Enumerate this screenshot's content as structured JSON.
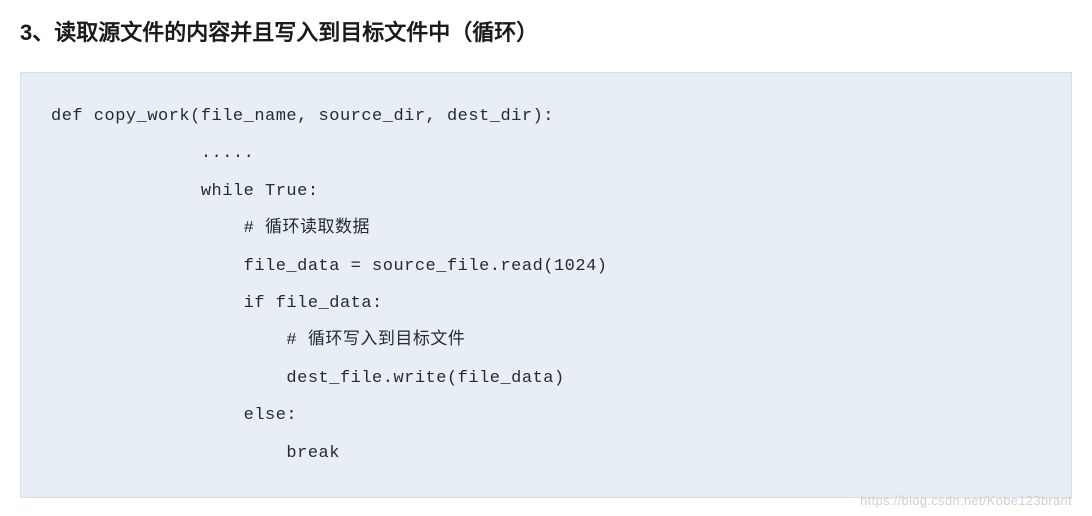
{
  "heading": "3、读取源文件的内容并且写入到目标文件中（循环）",
  "code": {
    "lines": [
      "def copy_work(file_name, source_dir, dest_dir):",
      "              .....",
      "              while True:",
      "                  # 循环读取数据",
      "                  file_data = source_file.read(1024)",
      "                  if file_data:",
      "                      # 循环写入到目标文件",
      "                      dest_file.write(file_data)",
      "                  else:",
      "                      break"
    ]
  },
  "watermark": "https://blog.csdn.net/Kobe123brant"
}
